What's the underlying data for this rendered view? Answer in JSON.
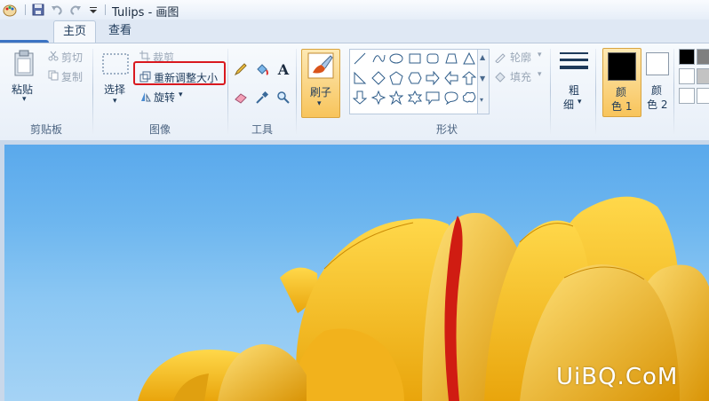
{
  "window": {
    "title": "Tulips - 画图"
  },
  "tabs": [
    {
      "label": "主页"
    },
    {
      "label": "查看"
    }
  ],
  "clipboard": {
    "paste": "粘贴",
    "cut": "剪切",
    "copy": "复制",
    "group": "剪贴板"
  },
  "image": {
    "select": "选择",
    "crop": "裁剪",
    "resize": "重新调整大小",
    "rotate": "旋转",
    "group": "图像"
  },
  "tools": {
    "group": "工具"
  },
  "brush": {
    "label": "刷子"
  },
  "shapes": {
    "outline": "轮廓",
    "fill": "填充",
    "group": "形状"
  },
  "size": {
    "line1": "粗",
    "line2": "细"
  },
  "colors": {
    "color1_a": "颜",
    "color1_b": "色 1",
    "color2_a": "颜",
    "color2_b": "色 2"
  },
  "watermark": "UiBQ.CoM",
  "palette": {
    "accent_yellow": "#f4b81f",
    "petal_red": "#d01c12",
    "sky": "#6db6ef",
    "highlight": "#d9191f"
  }
}
